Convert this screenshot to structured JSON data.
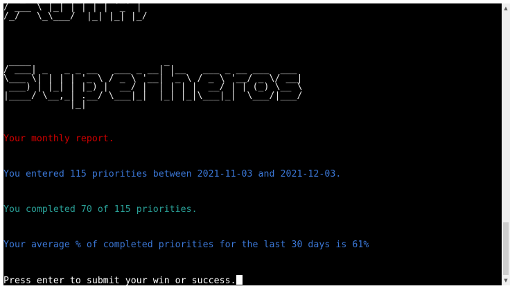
{
  "terminal": {
    "banner_top": " / _ \\| | | |_   _| |_| |\n/ ___ \\ |_| | | | |  _  |\n/_/   \\_\\___/  |_| |_| |_/",
    "banner_bottom": " ____                        _\n/ ___| _   _ _ __   ___ _ __| |__   ___ _ __ ___  ___\n\\___ \\| | | | '_ \\ / _ \\ '__| '_ \\ / _ \\ '__/ _ \\/ __|\n ___) | |_| | |_) |  __/ |  | | | |  __/ | | (_) \\__ \\\n|____/ \\__,_| .__/ \\___|_|  |_| |_|\\___|_|  \\___/|___/\n            |_|",
    "lines": [
      {
        "text": "Your monthly report.",
        "color": "#d40000"
      },
      {
        "text": "You entered 115 priorities between 2021-11-03 and 2021-12-03.",
        "color": "#3b78d8"
      },
      {
        "text": "You completed 70 of 115 priorities.",
        "color": "#2aa198"
      },
      {
        "text": "Your average % of completed priorities for the last 30 days is 61%",
        "color": "#3b78d8"
      }
    ],
    "prompt": "Press enter to submit your win or success.",
    "prompt_color": "#ffffff"
  },
  "scrollbar": {
    "up_icon": "arrow-up-icon",
    "down_icon": "arrow-down-icon",
    "position": 0.92
  }
}
